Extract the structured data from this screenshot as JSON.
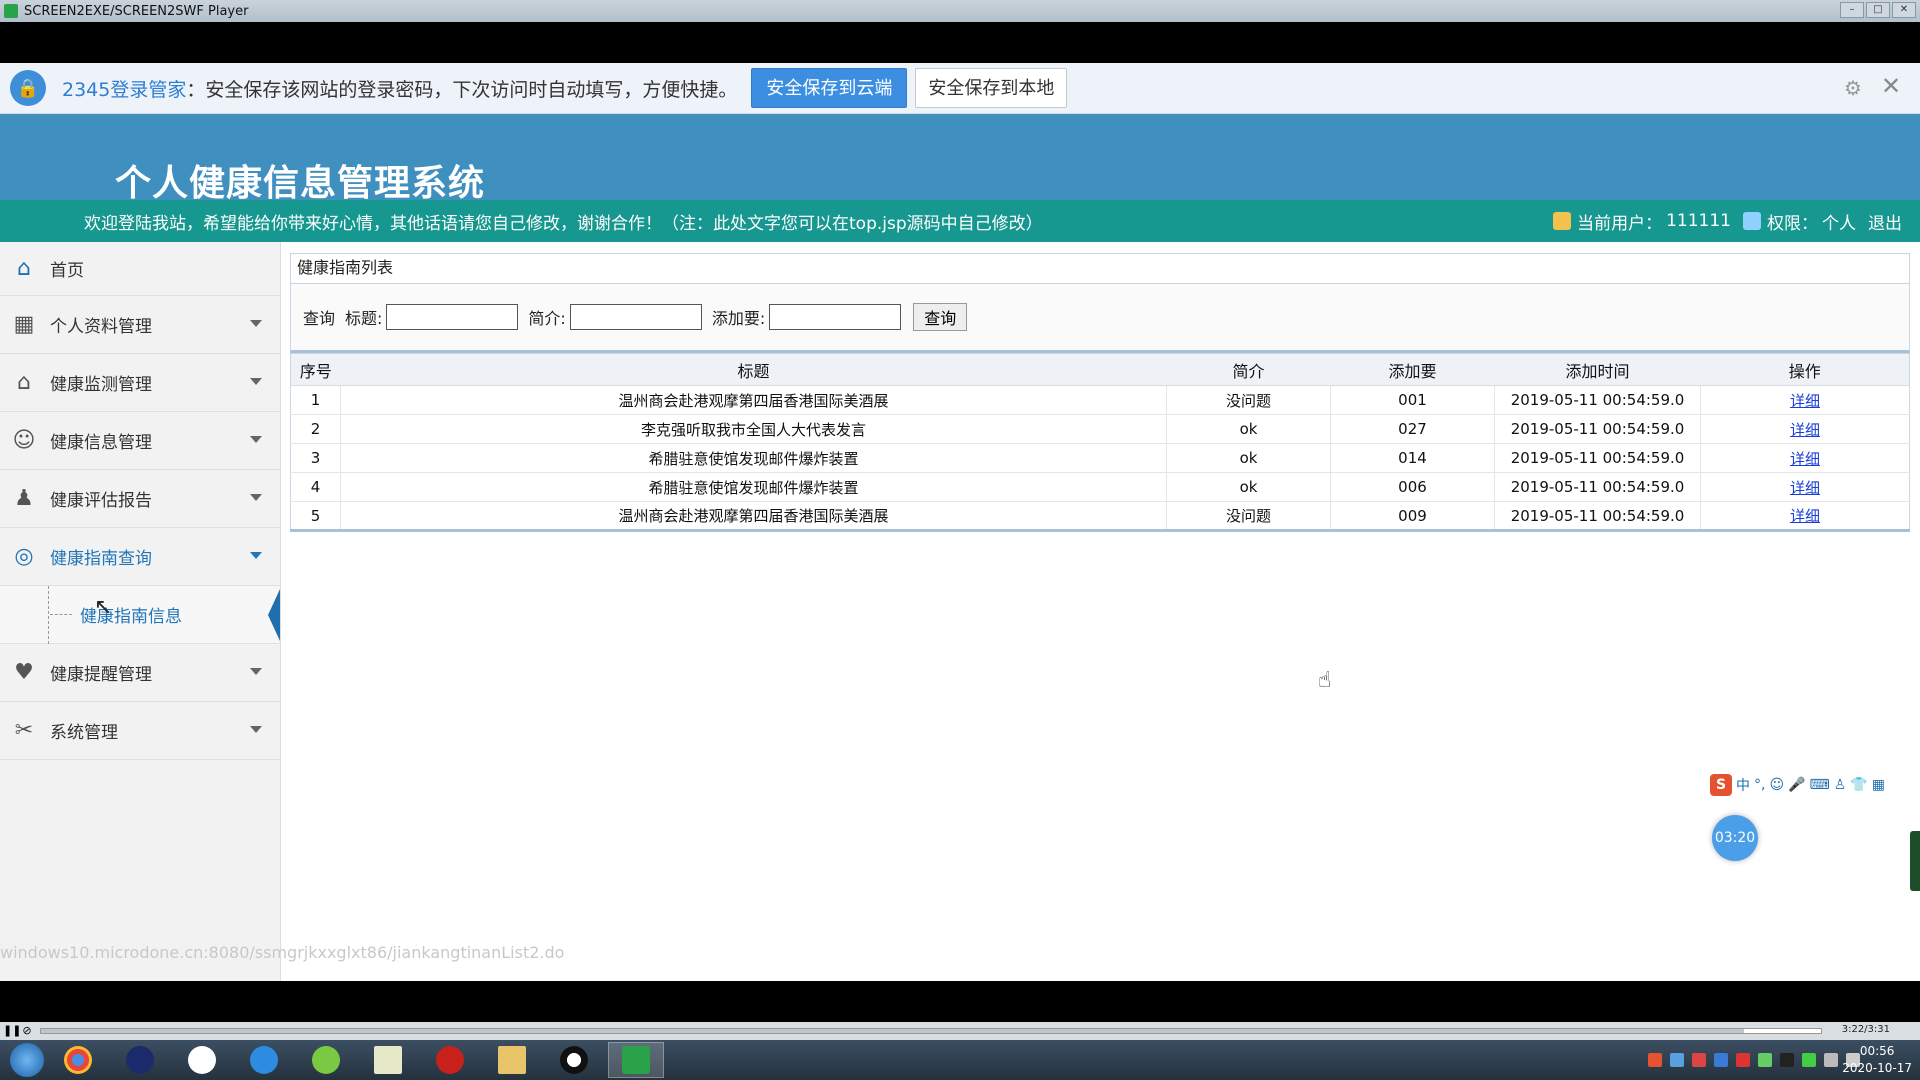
{
  "player": {
    "title": "SCREEN2EXE/SCREEN2SWF Player",
    "timecode": "3:22/3:31",
    "progress": 0.957
  },
  "password_bar": {
    "brand": "2345登录管家",
    "message": "：安全保存该网站的登录密码，下次访问时自动填写，方便快捷。",
    "save_cloud_label": "安全保存到云端",
    "save_local_label": "安全保存到本地"
  },
  "header": {
    "system_title": "个人健康信息管理系统",
    "welcome_text": "欢迎登陆我站，希望能给你带来好心情，其他话语请您自己修改，谢谢合作！（注：此处文字您可以在top.jsp源码中自己修改）",
    "current_user_label": "当前用户：",
    "current_user": "111111",
    "role_label": "权限：",
    "role": "个人",
    "logout_label": "退出"
  },
  "sidebar": {
    "items": [
      {
        "label": "首页",
        "icon": "home-icon"
      },
      {
        "label": "个人资料管理",
        "icon": "grid-icon"
      },
      {
        "label": "健康监测管理",
        "icon": "house-icon"
      },
      {
        "label": "健康信息管理",
        "icon": "users-icon"
      },
      {
        "label": "健康评估报告",
        "icon": "person-icon"
      },
      {
        "label": "健康指南查询",
        "icon": "chat-icon"
      },
      {
        "label": "健康提醒管理",
        "icon": "heart-icon"
      },
      {
        "label": "系统管理",
        "icon": "tools-icon"
      }
    ],
    "sub_item": "健康指南信息"
  },
  "main": {
    "panel_title": "健康指南列表",
    "search": {
      "query_label": "查询",
      "title_label": "标题:",
      "intro_label": "简介:",
      "adder_label": "添加要:",
      "button_label": "查询"
    },
    "table": {
      "headers": [
        "序号",
        "标题",
        "简介",
        "添加要",
        "添加时间",
        "操作"
      ],
      "rows": [
        {
          "no": "1",
          "title": "温州商会赴港观摩第四届香港国际美酒展",
          "intro": "没问题",
          "adder": "001",
          "time": "2019-05-11 00:54:59.0",
          "action": "详细"
        },
        {
          "no": "2",
          "title": "李克强听取我市全国人大代表发言",
          "intro": "ok",
          "adder": "027",
          "time": "2019-05-11 00:54:59.0",
          "action": "详细"
        },
        {
          "no": "3",
          "title": "希腊驻意使馆发现邮件爆炸装置",
          "intro": "ok",
          "adder": "014",
          "time": "2019-05-11 00:54:59.0",
          "action": "详细"
        },
        {
          "no": "4",
          "title": "希腊驻意使馆发现邮件爆炸装置",
          "intro": "ok",
          "adder": "006",
          "time": "2019-05-11 00:54:59.0",
          "action": "详细"
        },
        {
          "no": "5",
          "title": "温州商会赴港观摩第四届香港国际美酒展",
          "intro": "没问题",
          "adder": "009",
          "time": "2019-05-11 00:54:59.0",
          "action": "详细"
        }
      ]
    }
  },
  "status_url": "windows10.microdone.cn:8080/ssmgrjkxxglxt86/jiankangtinanList2.do",
  "timer": "03:20",
  "ime": {
    "lang": "中"
  },
  "clock": {
    "time": "00:56",
    "date": "2020-10-17"
  },
  "colors": {
    "header": "#3f8fbf",
    "welcome_bar": "#16978f",
    "accent": "#2175b8",
    "link": "#1a3fd6"
  }
}
